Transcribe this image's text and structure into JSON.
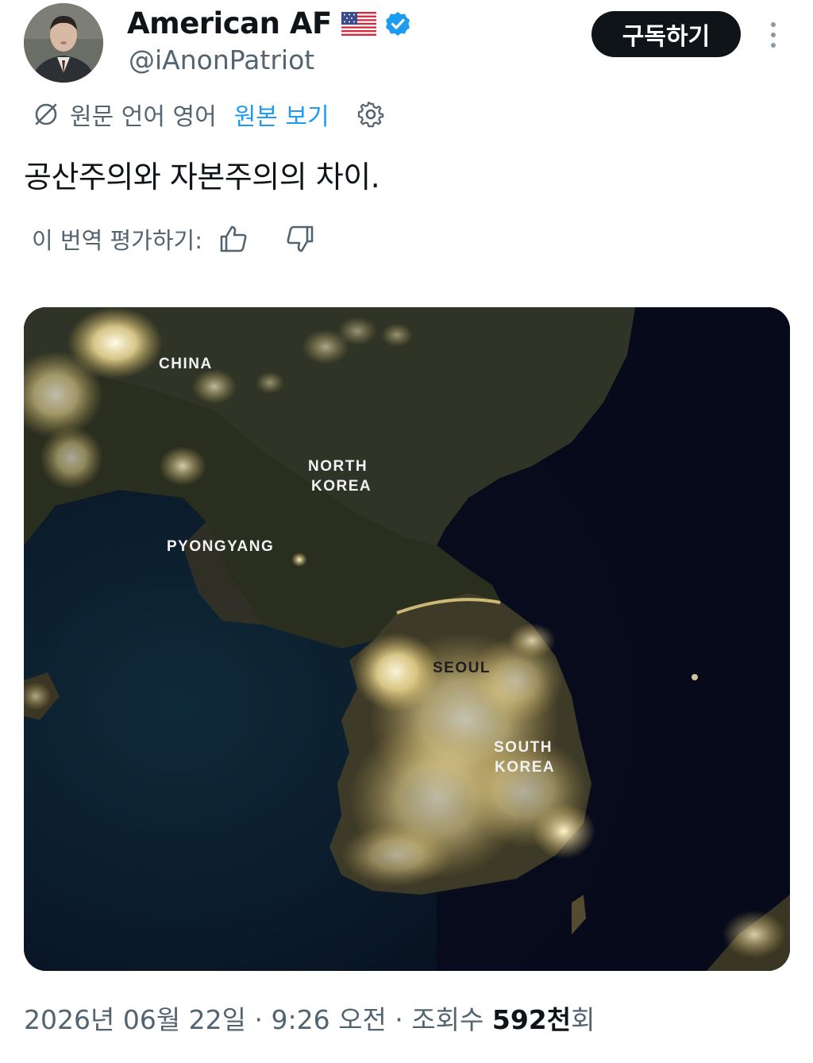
{
  "author": {
    "display_name": "American AF",
    "handle": "@iAnonPatriot",
    "avatar_icon": "profile-photo",
    "verified_color": "#1d9bf0"
  },
  "header": {
    "follow_label": "구독하기",
    "more_icon": "more-vertical-icon"
  },
  "translation": {
    "source_language": "원문 언어 영어",
    "show_original": "원본 보기",
    "rate_label": "이 번역 평가하기:"
  },
  "tweet": {
    "text": "공산주의와 자본주의의 차이."
  },
  "media": {
    "labels": {
      "china": "CHINA",
      "north_korea_1": "NORTH",
      "north_korea_2": "KOREA",
      "pyongyang": "PYONGYANG",
      "seoul": "SEOUL",
      "south_korea_1": "SOUTH",
      "south_korea_2": "KOREA"
    }
  },
  "meta": {
    "date_time": "2026년 06월 22일 · 9:26 오전 · 조회수 ",
    "views_value": "592천",
    "views_suffix": "회"
  },
  "colors": {
    "text_primary": "#0f1419",
    "text_secondary": "#536471",
    "link": "#1d9bf0",
    "button_bg": "#0f1419"
  }
}
